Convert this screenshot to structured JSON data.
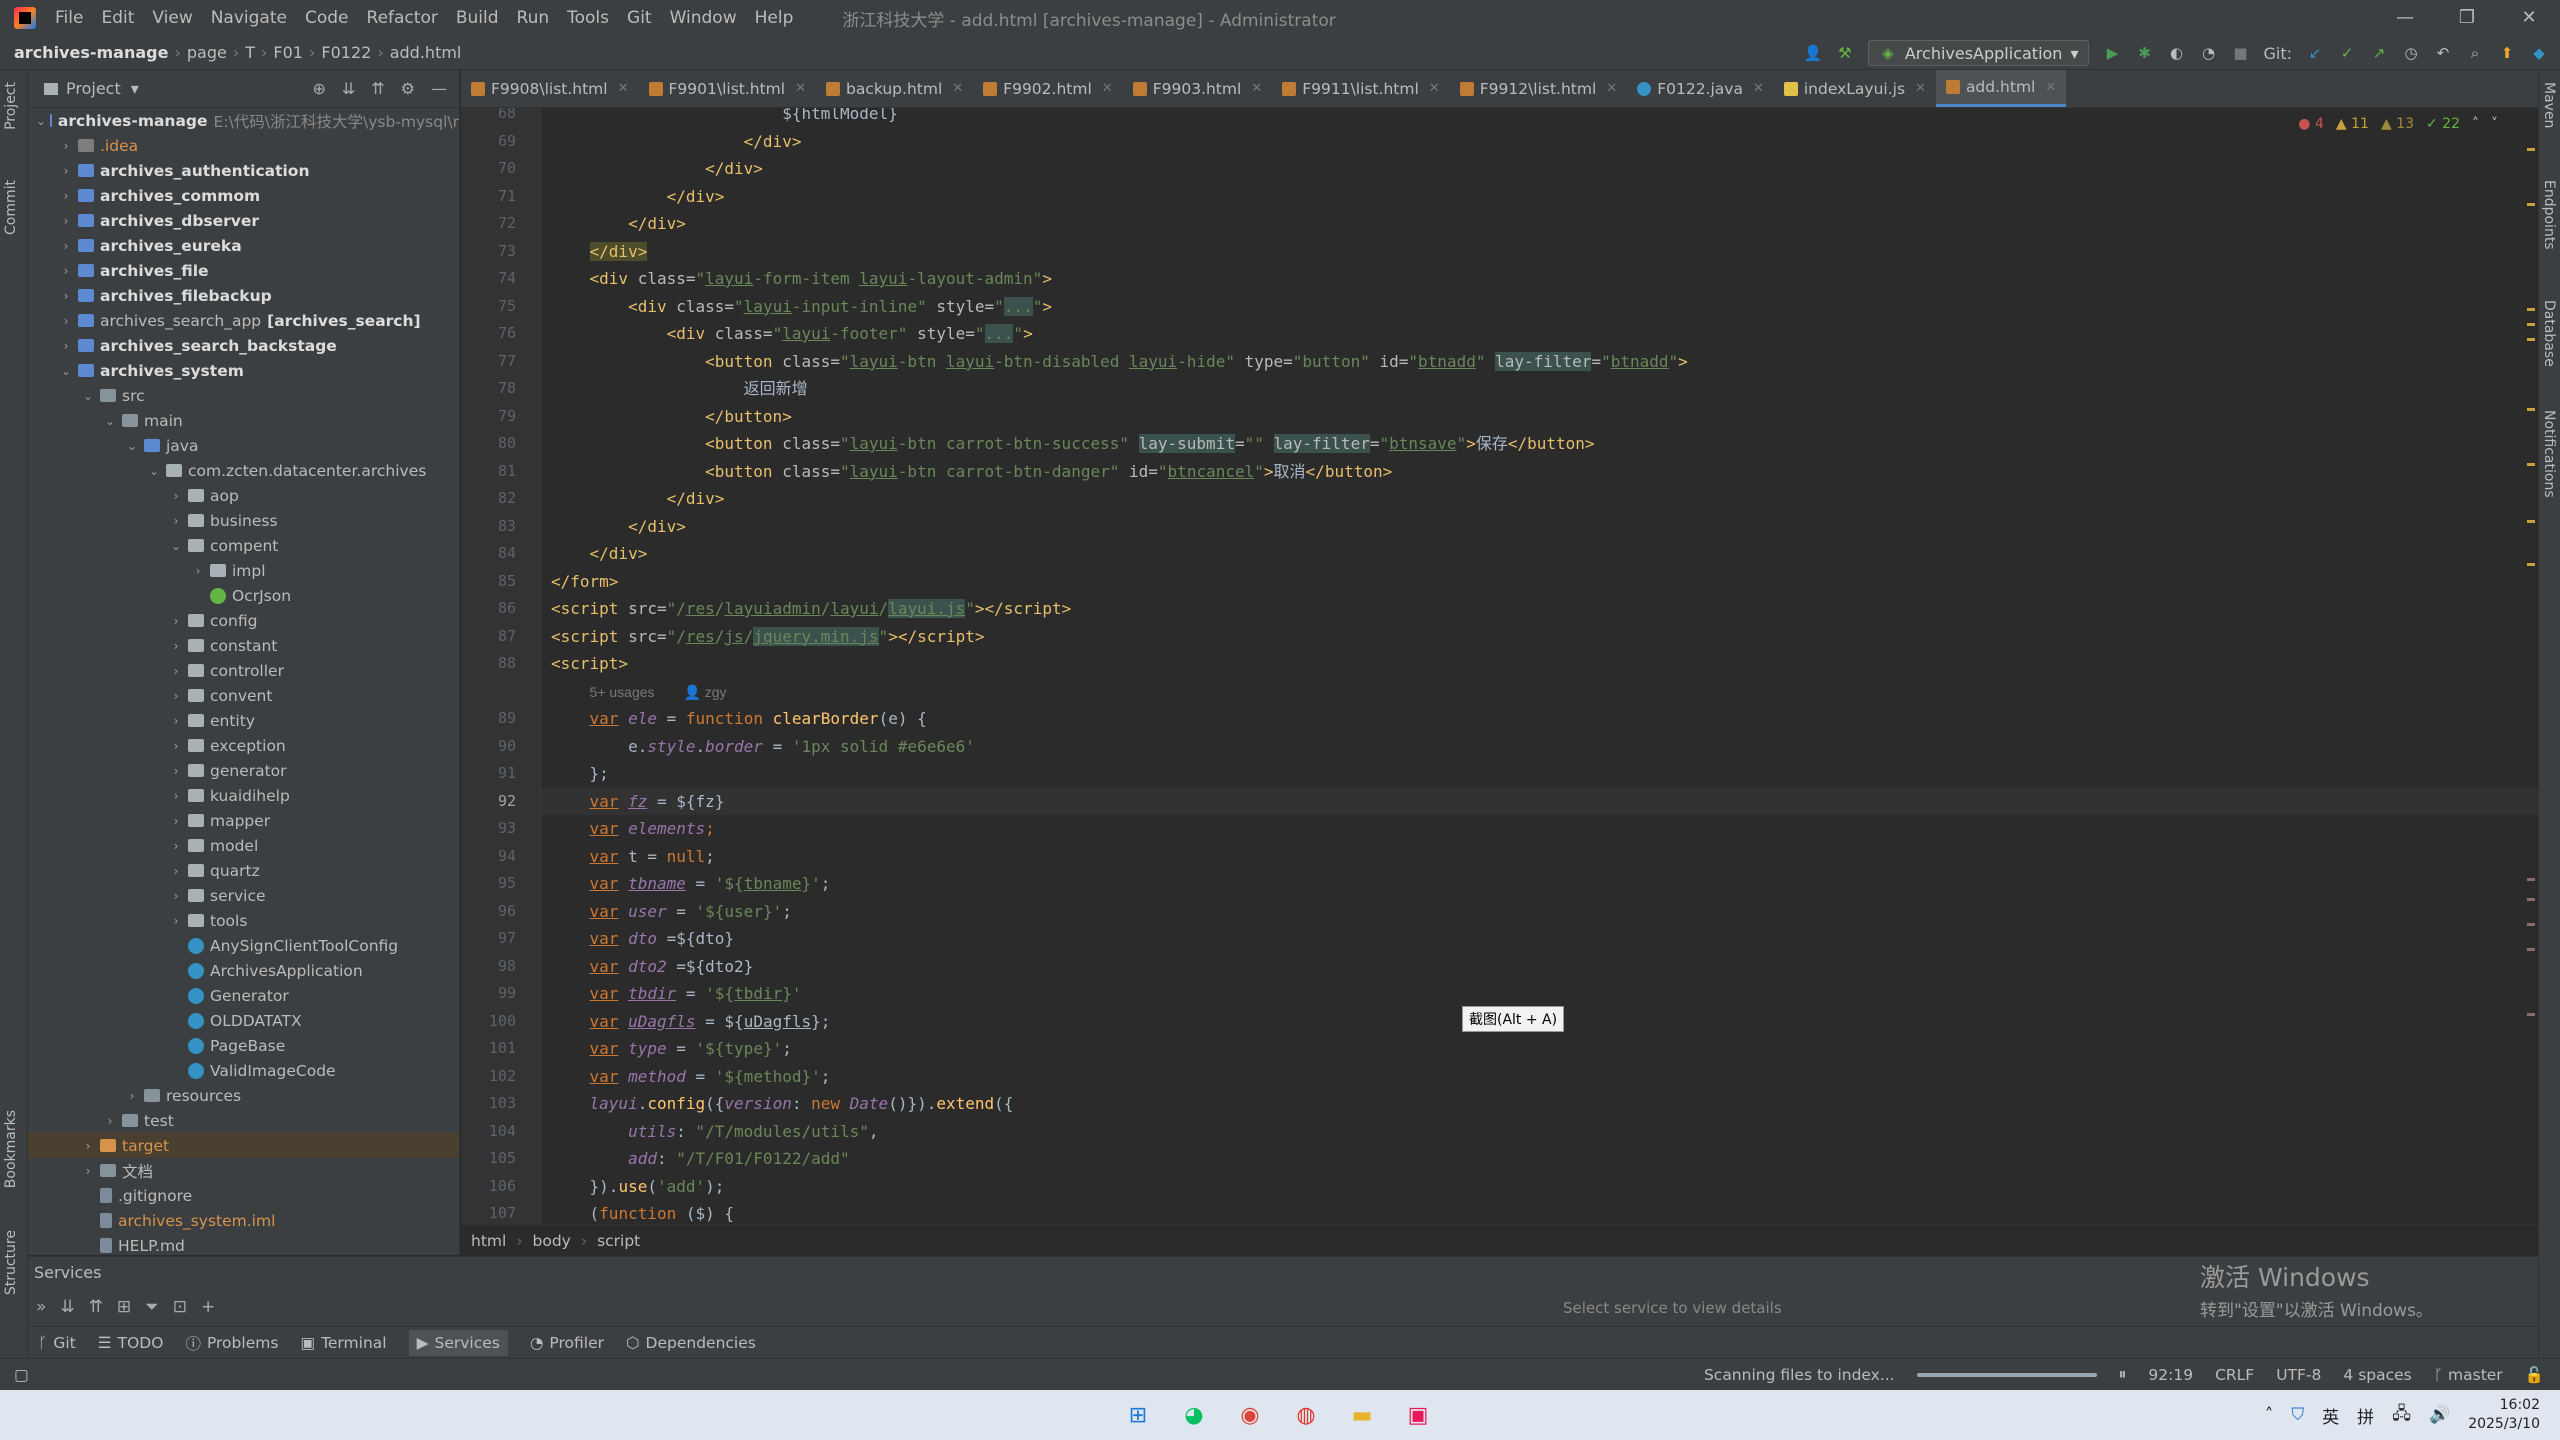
{
  "menubar": {
    "items": [
      "File",
      "Edit",
      "View",
      "Navigate",
      "Code",
      "Refactor",
      "Build",
      "Run",
      "Tools",
      "Git",
      "Window",
      "Help"
    ],
    "title": "浙江科技大学 - add.html [archives-manage] - Administrator"
  },
  "navbar": {
    "crumbs": [
      "archives-manage",
      "page",
      "T",
      "F01",
      "F0122",
      "add.html"
    ],
    "run_config": "ArchivesApplication",
    "git_label": "Git:"
  },
  "project": {
    "title": "Project",
    "tree": [
      {
        "indent": 0,
        "open": true,
        "icon": "mod",
        "label": "archives-manage",
        "bold": true,
        "dim": "E:\\代码\\浙江科技大学\\ysb-mysql\\r"
      },
      {
        "indent": 1,
        "icon": "idea",
        "label": ".idea",
        "orange": true
      },
      {
        "indent": 1,
        "icon": "mod",
        "label": "archives_authentication",
        "bold": true
      },
      {
        "indent": 1,
        "icon": "mod",
        "label": "archives_commom",
        "bold": true
      },
      {
        "indent": 1,
        "icon": "mod",
        "label": "archives_dbserver",
        "bold": true
      },
      {
        "indent": 1,
        "icon": "mod",
        "label": "archives_eureka",
        "bold": true
      },
      {
        "indent": 1,
        "icon": "mod",
        "label": "archives_file",
        "bold": true
      },
      {
        "indent": 1,
        "icon": "mod",
        "label": "archives_filebackup",
        "bold": true
      },
      {
        "indent": 1,
        "icon": "mod",
        "label": "archives_search_app",
        "bold_suffix": "[archives_search]"
      },
      {
        "indent": 1,
        "icon": "mod",
        "label": "archives_search_backstage",
        "bold": true
      },
      {
        "indent": 1,
        "open": true,
        "icon": "mod",
        "label": "archives_system",
        "bold": true
      },
      {
        "indent": 2,
        "open": true,
        "icon": "plain",
        "label": "src"
      },
      {
        "indent": 3,
        "open": true,
        "icon": "plain",
        "label": "main"
      },
      {
        "indent": 4,
        "open": true,
        "icon": "mod",
        "label": "java"
      },
      {
        "indent": 5,
        "open": true,
        "icon": "pkg",
        "label": "com.zcten.datacenter.archives"
      },
      {
        "indent": 6,
        "icon": "pkg",
        "label": "aop"
      },
      {
        "indent": 6,
        "icon": "pkg",
        "label": "business"
      },
      {
        "indent": 6,
        "open": true,
        "icon": "pkg",
        "label": "compent"
      },
      {
        "indent": 7,
        "icon": "pkg",
        "label": "impl"
      },
      {
        "indent": 7,
        "leaf": true,
        "icon": "clsg",
        "label": "OcrJson"
      },
      {
        "indent": 6,
        "icon": "pkg",
        "label": "config"
      },
      {
        "indent": 6,
        "icon": "pkg",
        "label": "constant"
      },
      {
        "indent": 6,
        "icon": "pkg",
        "label": "controller"
      },
      {
        "indent": 6,
        "icon": "pkg",
        "label": "convent"
      },
      {
        "indent": 6,
        "icon": "pkg",
        "label": "entity"
      },
      {
        "indent": 6,
        "icon": "pkg",
        "label": "exception"
      },
      {
        "indent": 6,
        "icon": "pkg",
        "label": "generator"
      },
      {
        "indent": 6,
        "icon": "pkg",
        "label": "kuaidihelp"
      },
      {
        "indent": 6,
        "icon": "pkg",
        "label": "mapper"
      },
      {
        "indent": 6,
        "icon": "pkg",
        "label": "model"
      },
      {
        "indent": 6,
        "icon": "pkg",
        "label": "quartz"
      },
      {
        "indent": 6,
        "icon": "pkg",
        "label": "service"
      },
      {
        "indent": 6,
        "icon": "pkg",
        "label": "tools"
      },
      {
        "indent": 6,
        "leaf": true,
        "icon": "cls",
        "label": "AnySignClientToolConfig"
      },
      {
        "indent": 6,
        "leaf": true,
        "icon": "cls",
        "label": "ArchivesApplication"
      },
      {
        "indent": 6,
        "leaf": true,
        "icon": "cls",
        "label": "Generator"
      },
      {
        "indent": 6,
        "leaf": true,
        "icon": "cls",
        "label": "OLDDATATX"
      },
      {
        "indent": 6,
        "leaf": true,
        "icon": "cls",
        "label": "PageBase"
      },
      {
        "indent": 6,
        "leaf": true,
        "icon": "cls",
        "label": "ValidImageCode"
      },
      {
        "indent": 4,
        "icon": "plain",
        "label": "resources"
      },
      {
        "indent": 3,
        "icon": "plain",
        "label": "test"
      },
      {
        "indent": 2,
        "icon": "orange",
        "label": "target",
        "orange": true,
        "sel": true
      },
      {
        "indent": 2,
        "icon": "plain",
        "label": "文档"
      },
      {
        "indent": 2,
        "leaf": true,
        "icon": "file",
        "label": ".gitignore"
      },
      {
        "indent": 2,
        "leaf": true,
        "icon": "file",
        "label": "archives_system.iml",
        "orange": true
      },
      {
        "indent": 2,
        "leaf": true,
        "icon": "file",
        "label": "HELP.md"
      }
    ]
  },
  "tabs": [
    {
      "label": "F9908\\list.html",
      "type": "html"
    },
    {
      "label": "F9901\\list.html",
      "type": "html"
    },
    {
      "label": "backup.html",
      "type": "html"
    },
    {
      "label": "F9902.html",
      "type": "html"
    },
    {
      "label": "F9903.html",
      "type": "html"
    },
    {
      "label": "F9911\\list.html",
      "type": "html"
    },
    {
      "label": "F9912\\list.html",
      "type": "html"
    },
    {
      "label": "F0122.java",
      "type": "java"
    },
    {
      "label": "indexLayui.js",
      "type": "js"
    },
    {
      "label": "add.html",
      "type": "html",
      "active": true
    }
  ],
  "inspections": {
    "errors": "4",
    "warnings": "11",
    "weak": "13",
    "ok": "22"
  },
  "editor": {
    "current_line": "92",
    "inlay": "5+ usages",
    "author": "zgy",
    "tooltip": "截图(Alt + A)"
  },
  "code_lines": [
    {
      "n": "68",
      "h": "                        ${htmlModel}"
    },
    {
      "n": "69",
      "h": "                    <span class=tg>&lt;/div&gt;</span>"
    },
    {
      "n": "70",
      "h": "                <span class=tg>&lt;/div&gt;</span>"
    },
    {
      "n": "71",
      "h": "            <span class=tg>&lt;/div&gt;</span>"
    },
    {
      "n": "72",
      "h": "        <span class=tg>&lt;/div&gt;</span>"
    },
    {
      "n": "73",
      "h": "    <span class='tg hlk'>&lt;/div&gt;</span>"
    },
    {
      "n": "74",
      "h": "    <span class=tg>&lt;div </span><span class=at>class=</span><span class=s>\"<span class=u>layui</span>-form-item <span class=u>layui</span>-layout-admin\"</span><span class=tg>&gt;</span>"
    },
    {
      "n": "75",
      "h": "        <span class=tg>&lt;div </span><span class=at>class=</span><span class=s>\"<span class=u>layui</span>-input-inline\"</span> <span class=at>style=</span><span class=s>\"<span class=hl>...</span>\"</span><span class=tg>&gt;</span>"
    },
    {
      "n": "76",
      "h": "            <span class=tg>&lt;div </span><span class=at>class=</span><span class=s>\"<span class=u>layui</span>-footer\"</span> <span class=at>style=</span><span class=s>\"<span class=hl>...</span>\"</span><span class=tg>&gt;</span>"
    },
    {
      "n": "77",
      "h": "                <span class=tg>&lt;button </span><span class=at>class=</span><span class=s>\"<span class=u>layui</span>-btn <span class=u>layui</span>-btn-disabled <span class=u>layui</span>-hide\"</span> <span class=at>type=</span><span class=s>\"button\"</span> <span class=at>id=</span><span class=s>\"<span class=u>btnadd</span>\"</span> <span class='at hl'>lay-filter</span><span class=at>=</span><span class=s>\"<span class=u>btnadd</span>\"</span><span class=tg>&gt;</span>"
    },
    {
      "n": "78",
      "h": "                    返回新增"
    },
    {
      "n": "79",
      "h": "                <span class=tg>&lt;/button&gt;</span>"
    },
    {
      "n": "80",
      "h": "                <span class=tg>&lt;button </span><span class=at>class=</span><span class=s>\"<span class=u>layui</span>-btn carrot-btn-success\"</span> <span class='at hl'>lay-submit</span><span class=at>=</span><span class=s>\"\"</span> <span class='at hl'>lay-filter</span><span class=at>=</span><span class=s>\"<span class=u>btnsave</span>\"</span><span class=tg>&gt;</span>保存<span class=tg>&lt;/button&gt;</span>"
    },
    {
      "n": "81",
      "h": "                <span class=tg>&lt;button </span><span class=at>class=</span><span class=s>\"<span class=u>layui</span>-btn carrot-btn-danger\"</span> <span class=at>id=</span><span class=s>\"<span class=u>btncancel</span>\"</span><span class=tg>&gt;</span>取消<span class=tg>&lt;/button&gt;</span>"
    },
    {
      "n": "82",
      "h": "            <span class=tg>&lt;/div&gt;</span>"
    },
    {
      "n": "83",
      "h": "        <span class=tg>&lt;/div&gt;</span>"
    },
    {
      "n": "84",
      "h": "    <span class=tg>&lt;/div&gt;</span>"
    },
    {
      "n": "85",
      "h": "<span class=tg>&lt;/form&gt;</span>"
    },
    {
      "n": "86",
      "h": "<span class=tg>&lt;script </span><span class=at>src=</span><span class=s>\"/<span class=u>res</span>/<span class=u>layuiadmin</span>/<span class=u>layui</span>/<span class='u hl'>layui.js</span>\"</span><span class=tg>&gt;&lt;/script&gt;</span>"
    },
    {
      "n": "87",
      "h": "<span class=tg>&lt;script </span><span class=at>src=</span><span class=s>\"/<span class=u>res</span>/<span class=u>js</span>/<span class='u hl'>jquery.min.js</span>\"</span><span class=tg>&gt;&lt;/script&gt;</span>"
    },
    {
      "n": "88",
      "h": "<span class=tg>&lt;script&gt;</span>"
    },
    {
      "n": "",
      "inlay": true
    },
    {
      "n": "89",
      "h": "    <span class='k u'>var</span> <span class=it>ele</span> = <span class=k>function</span> <span class=fn>clearBorder</span>(e) {"
    },
    {
      "n": "90",
      "h": "        e.<span class=it>style</span>.<span class=it>border</span> = <span class=s>'1px solid #e6e6e6'</span>"
    },
    {
      "n": "91",
      "h": "    };"
    },
    {
      "n": "92",
      "h": "    <span class='k u'>var</span> <span class='it u'>fz</span> = ${fz}",
      "cur": true
    },
    {
      "n": "93",
      "h": "    <span class='k u'>var</span> <span class=it>elements</span><span class=k>;</span>"
    },
    {
      "n": "94",
      "h": "    <span class='k u'>var</span> t = <span class=k>null</span>;"
    },
    {
      "n": "95",
      "h": "    <span class='k u'>var</span> <span class='it u'>tbname</span> = <span class=s>'${<span class=u>tbname</span>}'</span>;"
    },
    {
      "n": "96",
      "h": "    <span class='k u'>var</span> <span class=it>user</span> = <span class=s>'${user}'</span>;"
    },
    {
      "n": "97",
      "h": "    <span class='k u'>var</span> <span class=it>dto</span> =${dto}"
    },
    {
      "n": "98",
      "h": "    <span class='k u'>var</span> <span class=it>dto2</span> =${dto2}"
    },
    {
      "n": "99",
      "h": "    <span class='k u'>var</span> <span class='it u'>tbdir</span> = <span class=s>'${<span class=u>tbdir</span>}'</span>"
    },
    {
      "n": "100",
      "h": "    <span class='k u'>var</span> <span class='it u'>uDagfls</span> = ${<span class=u>uDagfls</span>};"
    },
    {
      "n": "101",
      "h": "    <span class='k u'>var</span> <span class=it>type</span> = <span class=s>'${type}'</span>;"
    },
    {
      "n": "102",
      "h": "    <span class='k u'>var</span> <span class=it>method</span> = <span class=s>'${method}'</span>;"
    },
    {
      "n": "103",
      "h": "    <span class=it>layui</span>.<span class=fn>config</span>({<span class=it>version</span>: <span class=k>new</span> <span class=it>Date</span>()}).<span class=fn>extend</span>({"
    },
    {
      "n": "104",
      "h": "        <span class=it>utils</span>: <span class=s>\"/T/modules/utils\"</span>,"
    },
    {
      "n": "105",
      "h": "        <span class=it>add</span>: <span class=s>\"/T/F01/F0122/add\"</span>"
    },
    {
      "n": "106",
      "h": "    }).<span class=fn>use</span>(<span class=s>'add'</span>);"
    },
    {
      "n": "107",
      "h": "    (<span class=k>function</span> ($) {"
    }
  ],
  "breadcrumb": [
    "html",
    "body",
    "script"
  ],
  "services": {
    "title": "Services",
    "hint": "Select service to view details"
  },
  "activation": {
    "line1": "激活 Windows",
    "line2": "转到\"设置\"以激活 Windows。"
  },
  "toolwindows": [
    "Git",
    "TODO",
    "Problems",
    "Terminal",
    "Services",
    "Profiler",
    "Dependencies"
  ],
  "status": {
    "scan": "Scanning files to index...",
    "pos": "92:19",
    "eol": "CRLF",
    "enc": "UTF-8",
    "indent": "4 spaces",
    "branch": "master"
  },
  "left_strip": [
    "Project",
    "Commit",
    "Bookmarks",
    "Structure"
  ],
  "right_strip": [
    "Maven",
    "Endpoints",
    "Database",
    "Notifications"
  ],
  "taskbar": {
    "time": "16:02",
    "date": "2025/3/10",
    "ime1": "英",
    "ime2": "拼"
  },
  "colors": {
    "accent": "#4a88c7",
    "bg": "#2b2b2b",
    "panel": "#3c3f41"
  }
}
